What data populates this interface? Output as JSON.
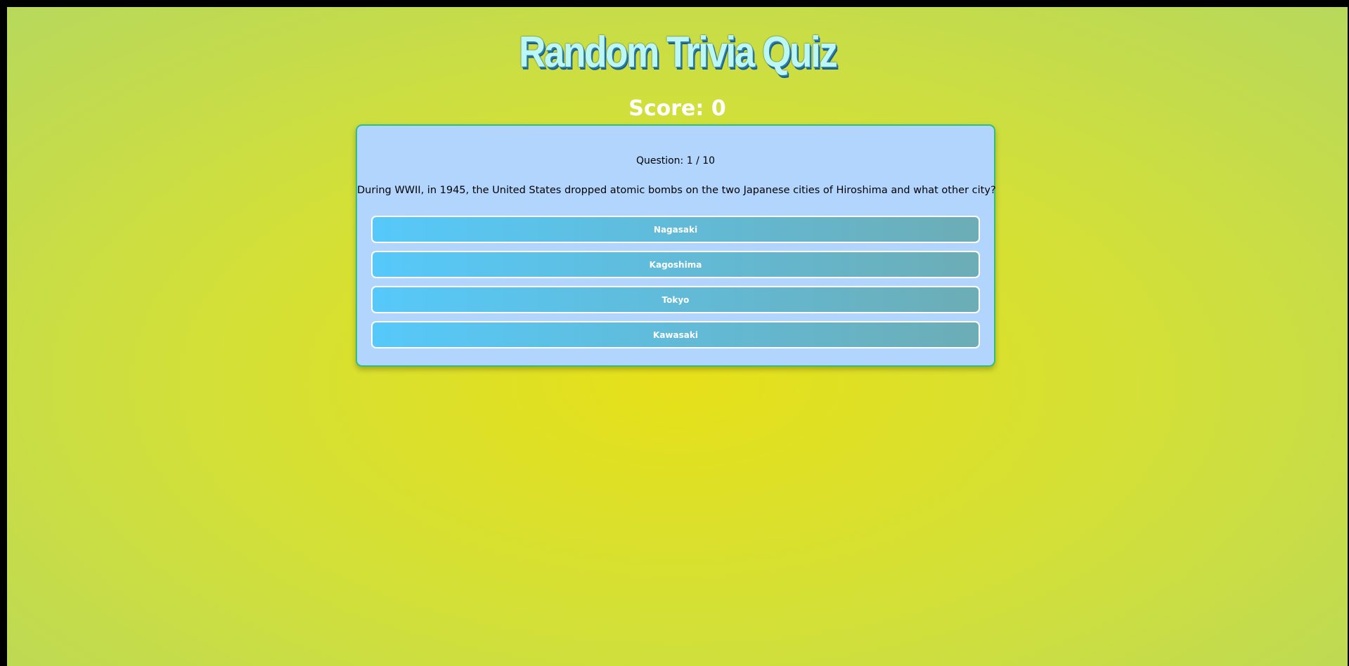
{
  "header": {
    "title": "Random Trivia Quiz",
    "score_text": "Score: 0"
  },
  "quiz": {
    "counter": "Question: 1 / 10",
    "question": "During WWII, in 1945, the United States dropped atomic bombs on the two Japanese cities of Hiroshima and what other city?",
    "answers": [
      {
        "label": "Nagasaki"
      },
      {
        "label": "Kagoshima"
      },
      {
        "label": "Tokyo"
      },
      {
        "label": "Kawasaki"
      }
    ]
  },
  "colors": {
    "background_center": "#e6e019",
    "background_edge": "#b6d85e",
    "card_background": "#b2d5fd",
    "card_border": "#2fc07e",
    "button_gradient_start": "#56c9fa",
    "button_gradient_end": "#6cadb6"
  }
}
